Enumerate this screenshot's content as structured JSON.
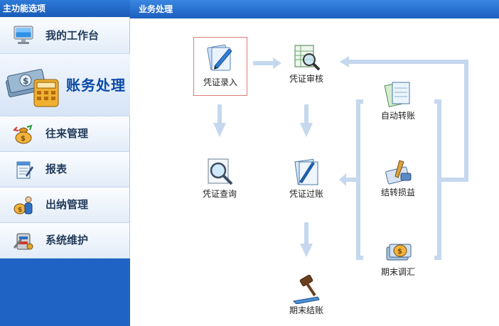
{
  "sidebar": {
    "header": "主功能选项",
    "items": [
      {
        "label": "我的工作台",
        "icon": "monitor-icon"
      },
      {
        "label": "账务处理",
        "icon": "money-calculator-icon"
      },
      {
        "label": "往来管理",
        "icon": "money-bag-icon"
      },
      {
        "label": "报表",
        "icon": "report-icon"
      },
      {
        "label": "出纳管理",
        "icon": "cashier-icon"
      },
      {
        "label": "系统维护",
        "icon": "tools-icon"
      }
    ],
    "active_index": 1
  },
  "content": {
    "header": "业务处理",
    "nodes": {
      "voucher_entry": "凭证录入",
      "voucher_review": "凭证审核",
      "auto_transfer": "自动转账",
      "voucher_query": "凭证查询",
      "voucher_post": "凭证过账",
      "pl_transfer": "结转损益",
      "period_adjust": "期末调汇",
      "period_close": "期末结账"
    },
    "selected_node": "voucher_entry"
  },
  "colors": {
    "sidebar_blue": "#1f63c4",
    "header_blue": "#2a72d4",
    "arrow": "#c5d8ee",
    "selection_border": "#e07a7a"
  }
}
